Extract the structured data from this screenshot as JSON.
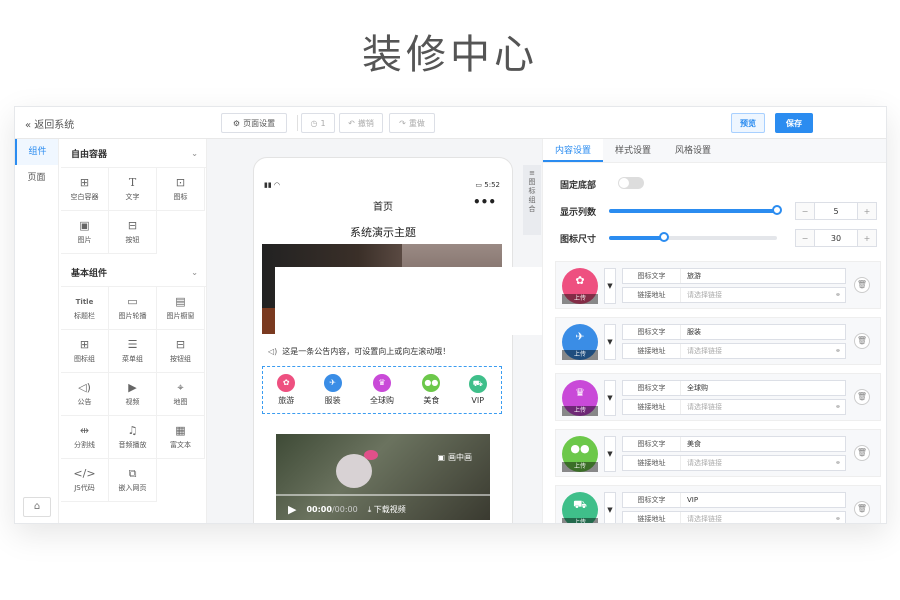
{
  "headline": "装修中心",
  "topbar": {
    "back_label": "返回系统",
    "page_settings": "页面设置",
    "history_count": "1",
    "undo": "撤销",
    "redo": "重做",
    "preview": "预览",
    "save": "保存"
  },
  "left_tabs": [
    {
      "label": "组件",
      "active": true
    },
    {
      "label": "页面",
      "active": false
    }
  ],
  "groups": [
    {
      "title": "自由容器",
      "items": [
        {
          "label": "空白容器",
          "icon": "grid-icon"
        },
        {
          "label": "文字",
          "icon": "text-icon"
        },
        {
          "label": "图标",
          "icon": "apps-icon"
        },
        {
          "label": "图片",
          "icon": "image-icon"
        },
        {
          "label": "按钮",
          "icon": "button-icon"
        }
      ]
    },
    {
      "title": "基本组件",
      "items": [
        {
          "label": "标题栏",
          "icon": "title-icon"
        },
        {
          "label": "图片轮播",
          "icon": "carousel-icon"
        },
        {
          "label": "图片橱窗",
          "icon": "showcase-icon"
        },
        {
          "label": "图标组",
          "icon": "icon-group-icon"
        },
        {
          "label": "菜单组",
          "icon": "menu-icon"
        },
        {
          "label": "按钮组",
          "icon": "button-group-icon"
        },
        {
          "label": "公告",
          "icon": "speaker-icon"
        },
        {
          "label": "视频",
          "icon": "video-icon"
        },
        {
          "label": "地图",
          "icon": "map-icon"
        },
        {
          "label": "分割线",
          "icon": "divider-icon"
        },
        {
          "label": "音频播放",
          "icon": "music-icon"
        },
        {
          "label": "富文本",
          "icon": "richtext-icon"
        },
        {
          "label": "JS代码",
          "icon": "code-icon"
        },
        {
          "label": "嵌入网页",
          "icon": "embed-icon"
        }
      ]
    }
  ],
  "phone": {
    "time": "5:52",
    "nav_title": "首页",
    "theme_title": "系统演示主题",
    "notice": "这是一条公告内容，可设置向上或向左滚动哦！",
    "nav_icons": [
      {
        "label": "旅游",
        "color": "#ee5080"
      },
      {
        "label": "服装",
        "color": "#3a8de6"
      },
      {
        "label": "全球购",
        "color": "#c94ad8"
      },
      {
        "label": "美食",
        "color": "#6cc84a"
      },
      {
        "label": "VIP",
        "color": "#3fbf8a"
      }
    ],
    "video": {
      "pip": "画中画",
      "time": "00:00",
      "duration": "/00:00",
      "download": "下载视频"
    }
  },
  "canvas_tab": "图标组合",
  "right": {
    "tabs": [
      {
        "label": "内容设置",
        "active": true
      },
      {
        "label": "样式设置",
        "active": false
      },
      {
        "label": "风格设置",
        "active": false
      }
    ],
    "fixed_bottom_label": "固定底部",
    "columns_label": "显示列数",
    "columns_value": "5",
    "columns_fraction": 1.0,
    "icon_size_label": "图标尺寸",
    "icon_size_value": "30",
    "icon_size_fraction": 0.33,
    "upload_label": "上传",
    "text_field_label": "图标文字",
    "link_field_label": "链接地址",
    "link_placeholder": "请选择链接",
    "items": [
      {
        "text": "旅游",
        "color": "#ee5080"
      },
      {
        "text": "服装",
        "color": "#3a8de6"
      },
      {
        "text": "全球购",
        "color": "#c94ad8"
      },
      {
        "text": "美食",
        "color": "#6cc84a"
      },
      {
        "text": "VIP",
        "color": "#3fbf8a"
      }
    ]
  }
}
